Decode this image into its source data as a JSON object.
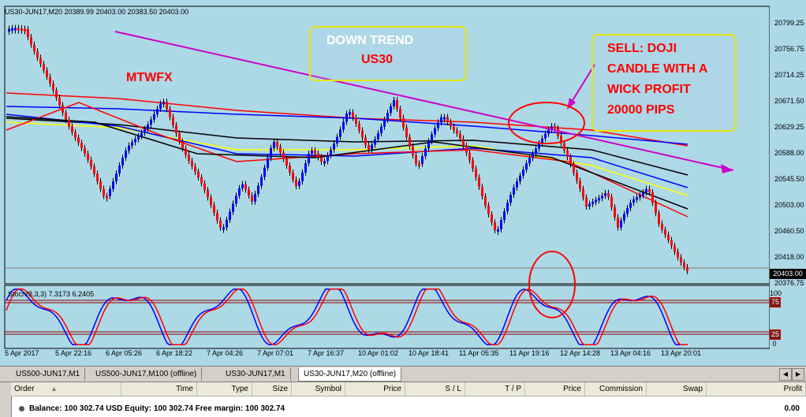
{
  "chart": {
    "title": "US30-JUN17,M20  20389.99 20403.00 20383.50 20403.00",
    "stoch_label": "Stoch(8,3,3) 7.3173 6.2405",
    "price_ticks": [
      "20799.25",
      "20756.75",
      "20714.25",
      "20671.50",
      "20629.25",
      "20588.00",
      "20545.50",
      "20503.00",
      "20460.50",
      "20418.00",
      "20376.75"
    ],
    "current_price": "20403.00",
    "stoch_levels": [
      {
        "text": "100",
        "style": "plain"
      },
      {
        "text": "75",
        "style": "box"
      },
      {
        "text": "25",
        "style": "box"
      },
      {
        "text": "0",
        "style": "plain"
      }
    ],
    "time_labels": [
      "5 Apr 2017",
      "5 Apr 22:16",
      "6 Apr 05:26",
      "6 Apr 18:22",
      "7 Apr 04:26",
      "7 Apr 07:01",
      "7 Apr 16:37",
      "10 Apr 01:02",
      "10 Apr 18:41",
      "11 Apr 05:35",
      "11 Apr 19:16",
      "12 Apr 14:28",
      "13 Apr 04:16",
      "13 Apr 20:01"
    ],
    "annotations": {
      "down_trend": "DOWN TREND",
      "symbol": "US30",
      "brand": "MTWFX",
      "sell_line1": "SELL: DOJI",
      "sell_line2": "CANDLE WITH A",
      "sell_line3": "WICK PROFIT",
      "sell_line4": "20000 PIPS"
    },
    "colors": {
      "background": "#add8e6",
      "bull": "#0000ff",
      "bear": "#ff0000",
      "trendline": "#cc00cc",
      "annotation_text": "#ff0000",
      "annotation_box": "#e8e800"
    }
  },
  "tabs": [
    {
      "label": "US500-JUN17,M1",
      "active": false
    },
    {
      "label": "US500-JUN17,M100 (offline)",
      "active": false
    },
    {
      "label": "US30-JUN17,M1",
      "active": false
    },
    {
      "label": "US30-JUN17,M20 (offline)",
      "active": true
    }
  ],
  "terminal": {
    "columns": [
      "Order",
      "Time",
      "Type",
      "Size",
      "Symbol",
      "Price",
      "S / L",
      "T / P",
      "Price",
      "Commission",
      "Swap",
      "Profit"
    ],
    "balance_text": "Balance: 100 302.74 USD  Equity: 100 302.74  Free margin: 100 302.74",
    "profit": "0.00"
  }
}
